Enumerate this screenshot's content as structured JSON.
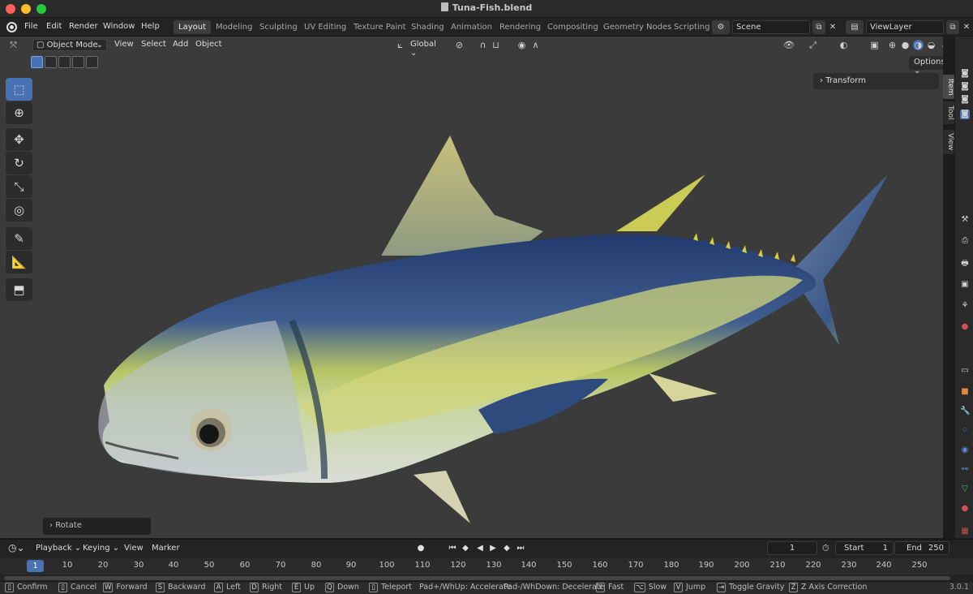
{
  "window": {
    "title": "Tuna-Fish.blend"
  },
  "menus": [
    "File",
    "Edit",
    "Render",
    "Window",
    "Help"
  ],
  "workspaces": [
    "Layout",
    "Modeling",
    "Sculpting",
    "UV Editing",
    "Texture Paint",
    "Shading",
    "Animation",
    "Rendering",
    "Compositing",
    "Geometry Nodes",
    "Scripting"
  ],
  "active_workspace": "Layout",
  "scene": {
    "value": "Scene"
  },
  "view_layer": {
    "value": "ViewLayer"
  },
  "viewport_header": {
    "mode": "Object Mode",
    "menus": [
      "View",
      "Select",
      "Add",
      "Object"
    ],
    "orientation": "Global",
    "options_label": "Options"
  },
  "sidebar": {
    "transform_label": "Transform",
    "tabs": [
      "Item",
      "Tool",
      "View"
    ]
  },
  "last_operator": "Rotate",
  "timeline": {
    "menus": [
      "Playback",
      "Keying",
      "View",
      "Marker"
    ],
    "current_frame": "1",
    "start_label": "Start",
    "start_value": "1",
    "end_label": "End",
    "end_value": "250",
    "ruler_ticks": [
      "1",
      "10",
      "20",
      "30",
      "40",
      "50",
      "60",
      "70",
      "80",
      "90",
      "100",
      "110",
      "120",
      "130",
      "140",
      "150",
      "160",
      "170",
      "180",
      "190",
      "200",
      "210",
      "220",
      "230",
      "240",
      "250"
    ]
  },
  "statusbar": {
    "hints": [
      {
        "key": "",
        "label": "Confirm"
      },
      {
        "key": "",
        "label": "Cancel"
      },
      {
        "key": "W",
        "label": "Forward"
      },
      {
        "key": "S",
        "label": "Backward"
      },
      {
        "key": "A",
        "label": "Left"
      },
      {
        "key": "D",
        "label": "Right"
      },
      {
        "key": "E",
        "label": "Up"
      },
      {
        "key": "Q",
        "label": "Down"
      },
      {
        "key": "",
        "label": "Teleport"
      },
      {
        "key": "",
        "label": "Pad+/WhUp: Accelerate"
      },
      {
        "key": "",
        "label": "Pad-/WhDown: Decelerate"
      },
      {
        "key": "",
        "label": "Fast"
      },
      {
        "key": "",
        "label": "Slow"
      },
      {
        "key": "V",
        "label": "Jump"
      },
      {
        "key": "",
        "label": "Toggle Gravity"
      },
      {
        "key": "Z",
        "label": "Z Axis Correction"
      }
    ],
    "version": "3.0.1"
  }
}
